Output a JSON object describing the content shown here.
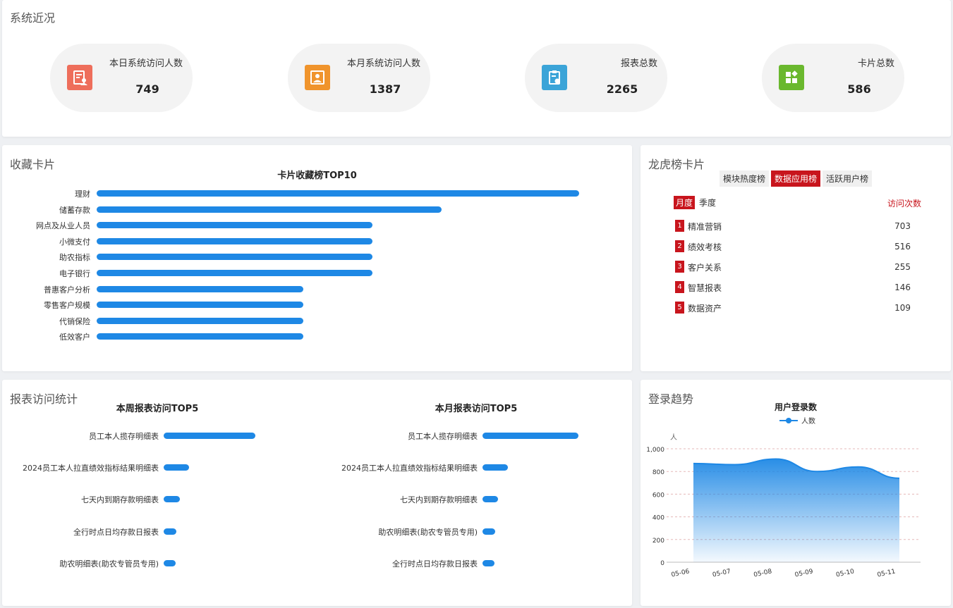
{
  "overview": {
    "title": "系统近况",
    "stats": [
      {
        "label": "本日系统访问人数",
        "value": "749",
        "icon": "user-report-icon",
        "color": "#ee6e5b"
      },
      {
        "label": "本月系统访问人数",
        "value": "1387",
        "icon": "contact-card-icon",
        "color": "#f0942c"
      },
      {
        "label": "报表总数",
        "value": "2265",
        "icon": "clipboard-check-icon",
        "color": "#3ba4d8"
      },
      {
        "label": "卡片总数",
        "value": "586",
        "icon": "widgets-icon",
        "color": "#6ab82e"
      }
    ]
  },
  "favorites": {
    "title": "收藏卡片",
    "chart_data": {
      "type": "bar",
      "title": "卡片收藏榜TOP10",
      "categories": [
        "理财",
        "储蓄存款",
        "网点及从业人员",
        "小微支付",
        "助农指标",
        "电子银行",
        "普惠客户分析",
        "零售客户规模",
        "代销保险",
        "低效客户"
      ],
      "values": [
        7,
        5,
        4,
        4,
        4,
        4,
        3,
        3,
        3,
        3
      ],
      "xlim": [
        0,
        7
      ]
    }
  },
  "rank": {
    "title": "龙虎榜卡片",
    "tabs": [
      "模块热度榜",
      "数据应用榜",
      "活跃用户榜"
    ],
    "active_tab": 1,
    "periods": [
      "月度",
      "季度"
    ],
    "active_period": 0,
    "visits_header": "访问次数",
    "rows": [
      {
        "no": "1",
        "name": "精准营销",
        "value": "703"
      },
      {
        "no": "2",
        "name": "绩效考核",
        "value": "516"
      },
      {
        "no": "3",
        "name": "客户关系",
        "value": "255"
      },
      {
        "no": "4",
        "name": "智慧报表",
        "value": "146"
      },
      {
        "no": "5",
        "name": "数据资产",
        "value": "109"
      }
    ]
  },
  "report": {
    "title": "报表访问统计",
    "charts": [
      {
        "type": "bar",
        "title": "本周报表访问TOP5",
        "categories": [
          "员工本人揽存明细表",
          "2024员工本人拉直绩效指标结果明细表",
          "七天内到期存款明细表",
          "全行时点日均存款日报表",
          "助农明细表(助农专管员专用)"
        ],
        "values": [
          100,
          28,
          18,
          14,
          13
        ],
        "xlim": [
          0,
          160
        ]
      },
      {
        "type": "bar",
        "title": "本月报表访问TOP5",
        "categories": [
          "员工本人揽存明细表",
          "2024员工本人拉直绩效指标结果明细表",
          "七天内到期存款明细表",
          "助农明细表(助农专管员专用)",
          "全行时点日均存款日报表"
        ],
        "values": [
          150,
          40,
          24,
          20,
          19
        ],
        "xlim": [
          0,
          200
        ]
      }
    ]
  },
  "trend": {
    "title": "登录趋势",
    "chart_data": {
      "type": "area",
      "title": "用户登录数",
      "ylabel": "人",
      "series": [
        {
          "name": "人数",
          "values": [
            870,
            860,
            910,
            800,
            840,
            740
          ]
        }
      ],
      "x": [
        "05-06",
        "05-07",
        "05-08",
        "05-09",
        "05-10",
        "05-11"
      ],
      "ylim": [
        0,
        1000
      ],
      "yticks": [
        "0",
        "200",
        "400",
        "600",
        "800",
        "1,000"
      ],
      "color": "#1e88e5"
    }
  }
}
